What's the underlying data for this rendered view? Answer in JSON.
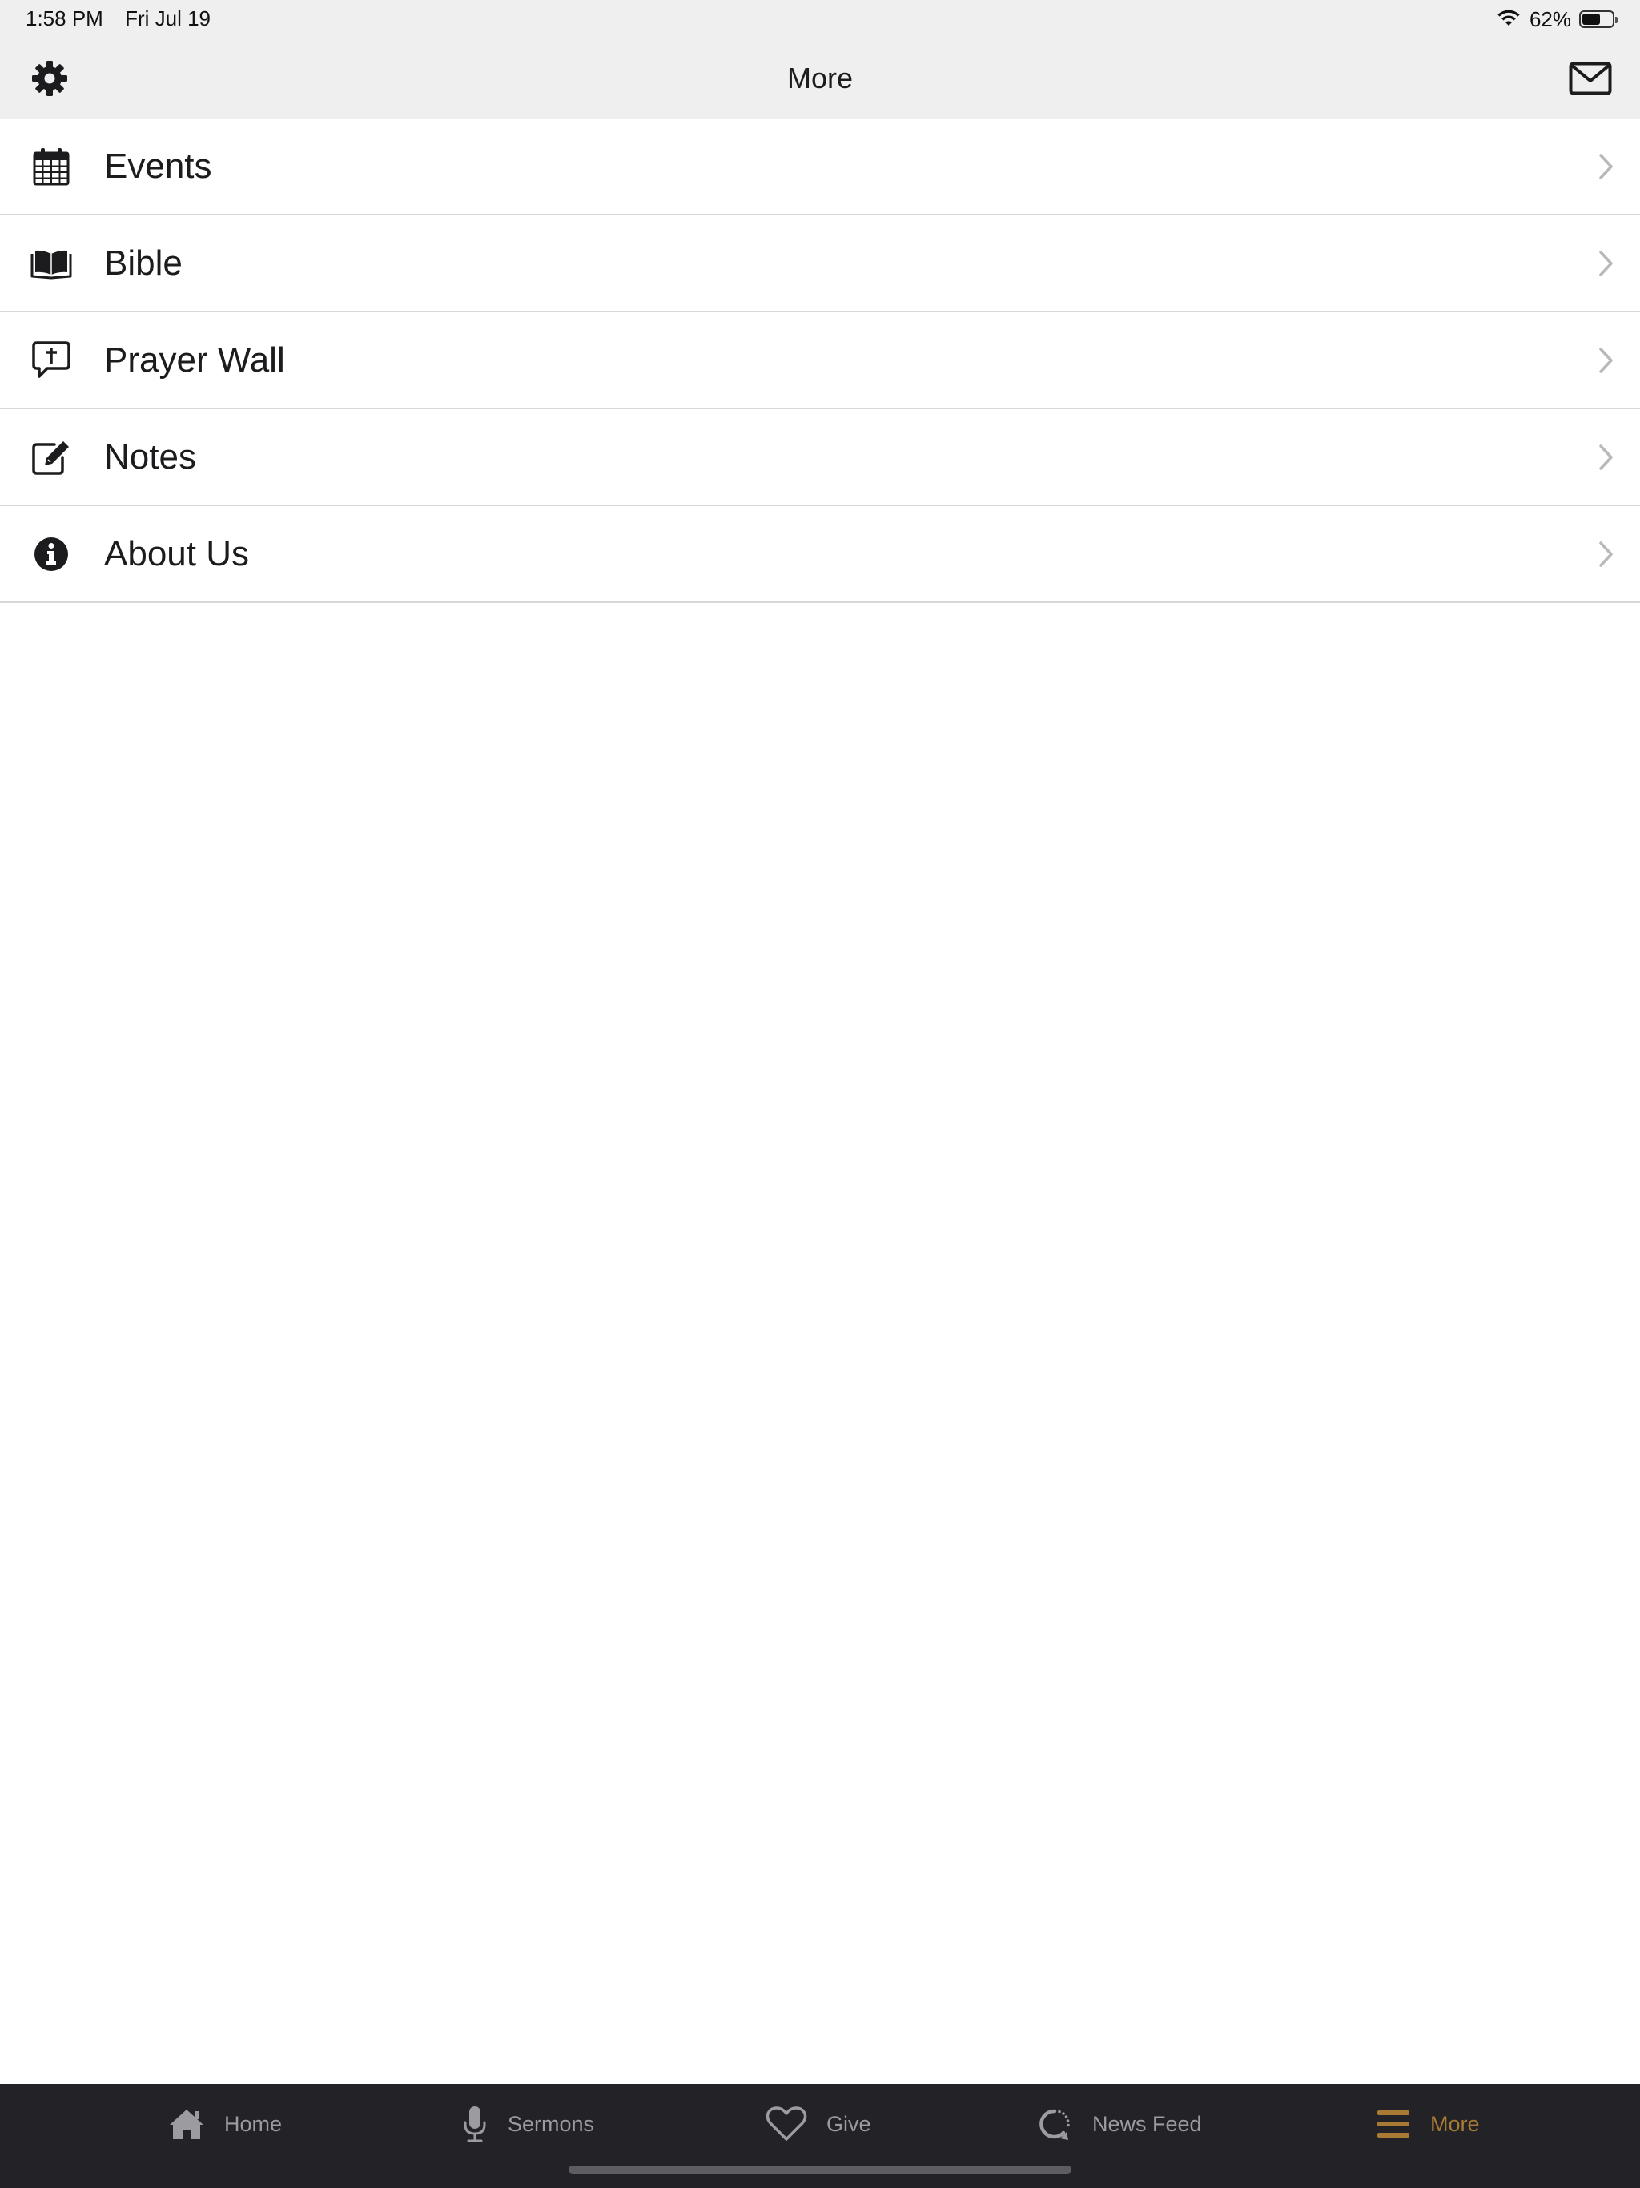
{
  "status_bar": {
    "time": "1:58 PM",
    "date": "Fri Jul 19",
    "battery_percent": "62%",
    "battery_level": 0.62,
    "wifi_icon": "wifi-icon"
  },
  "nav": {
    "title": "More",
    "left_icon": "gear-icon",
    "right_icon": "mail-icon"
  },
  "menu": {
    "items": [
      {
        "label": "Events",
        "icon": "calendar-icon"
      },
      {
        "label": "Bible",
        "icon": "open-book-icon"
      },
      {
        "label": "Prayer Wall",
        "icon": "prayer-bubble-icon"
      },
      {
        "label": "Notes",
        "icon": "edit-icon"
      },
      {
        "label": "About Us",
        "icon": "info-icon"
      }
    ]
  },
  "tabs": {
    "items": [
      {
        "label": "Home",
        "icon": "home-icon"
      },
      {
        "label": "Sermons",
        "icon": "microphone-icon"
      },
      {
        "label": "Give",
        "icon": "heart-icon"
      },
      {
        "label": "News Feed",
        "icon": "refresh-icon"
      },
      {
        "label": "More",
        "icon": "menu-icon",
        "active": true
      }
    ]
  },
  "colors": {
    "accent": "#a87a33",
    "tab_bar_bg": "#232227",
    "tab_inactive": "#9b9ba0",
    "header_bg": "#efefef",
    "divider": "#d8d8d8"
  }
}
